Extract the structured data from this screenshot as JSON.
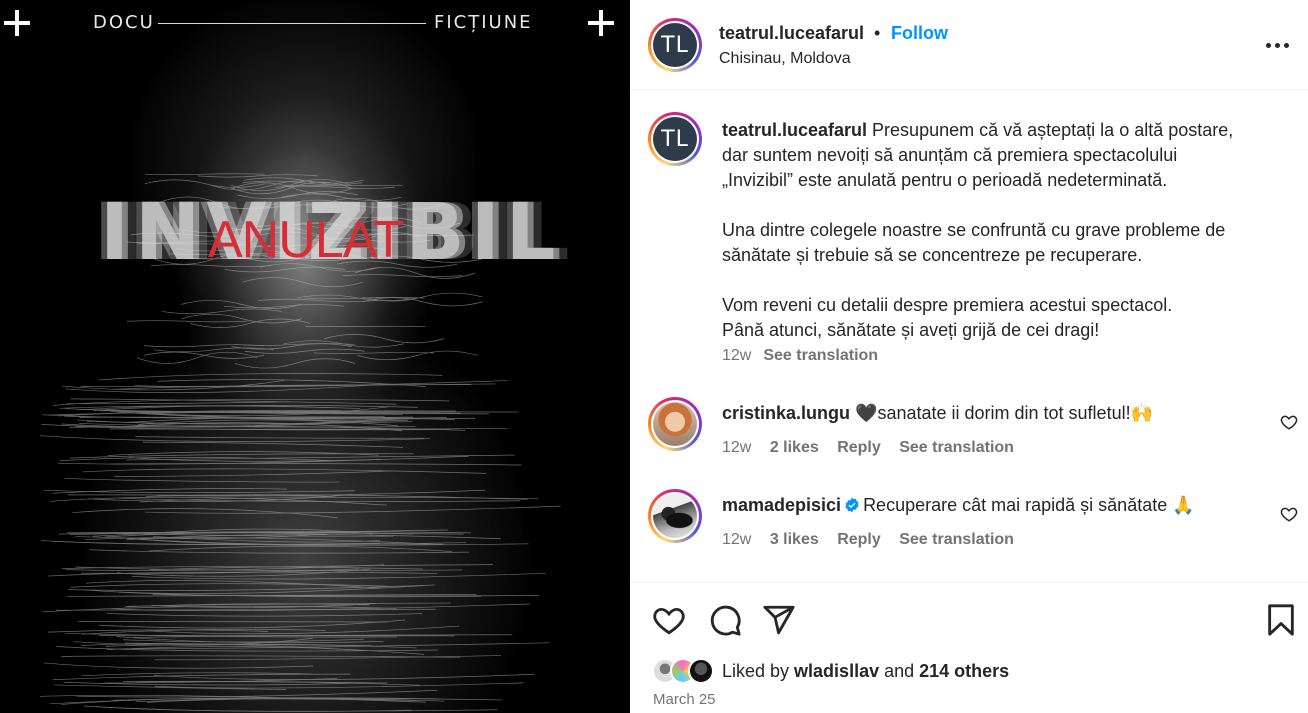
{
  "post_image": {
    "top_left_word": "DOCU",
    "top_right_word": "FICȚIUNE",
    "title_text": "INVIZIBIL",
    "overlay_text": "ANULAT",
    "overlay_color": "#d72d36",
    "corner_icon": "plus-icon"
  },
  "header": {
    "avatar_initials": "TL",
    "username": "teatrul.luceafarul",
    "separator": "•",
    "follow_label": "Follow",
    "location": "Chisinau, Moldova",
    "more_icon": "more-horizontal-icon"
  },
  "caption": {
    "avatar_initials": "TL",
    "username": "teatrul.luceafarul",
    "text": " Presupunem că vă așteptați la o altă postare,\ndar suntem nevoiți să anunțăm că premiera spectacolului\n„Invizibil” este anulată pentru o perioadă nedeterminată.\n\nUna dintre colegele noastre se confruntă cu grave probleme de\nsănătate și trebuie să se concentreze pe recuperare.\n\nVom reveni cu detalii despre premiera acestui spectacol.\nPână atunci, sănătate și aveți grijă de cei dragi!",
    "age": "12w",
    "see_translation": "See translation"
  },
  "comments": [
    {
      "username": "cristinka.lungu",
      "text": " 🖤sanatate ii dorim din tot sufletul!🙌",
      "age": "12w",
      "likes": "2 likes",
      "reply": "Reply",
      "see_translation": "See translation",
      "verified": false
    },
    {
      "username": "mamadepisici",
      "text": "Recuperare cât mai rapidă și sănătate 🙏",
      "age": "12w",
      "likes": "3 likes",
      "reply": "Reply",
      "see_translation": "See translation",
      "verified": true
    }
  ],
  "actions": {
    "icons": [
      "heart-icon",
      "comment-icon",
      "share-icon",
      "bookmark-icon"
    ],
    "liked_by_prefix": "Liked by ",
    "liked_by_user": "wladisllav",
    "liked_by_and": " and ",
    "liked_by_others": "214 others",
    "date": "March 25"
  },
  "colors": {
    "link_blue": "#0095f6",
    "muted": "#737373",
    "text": "#262626"
  }
}
